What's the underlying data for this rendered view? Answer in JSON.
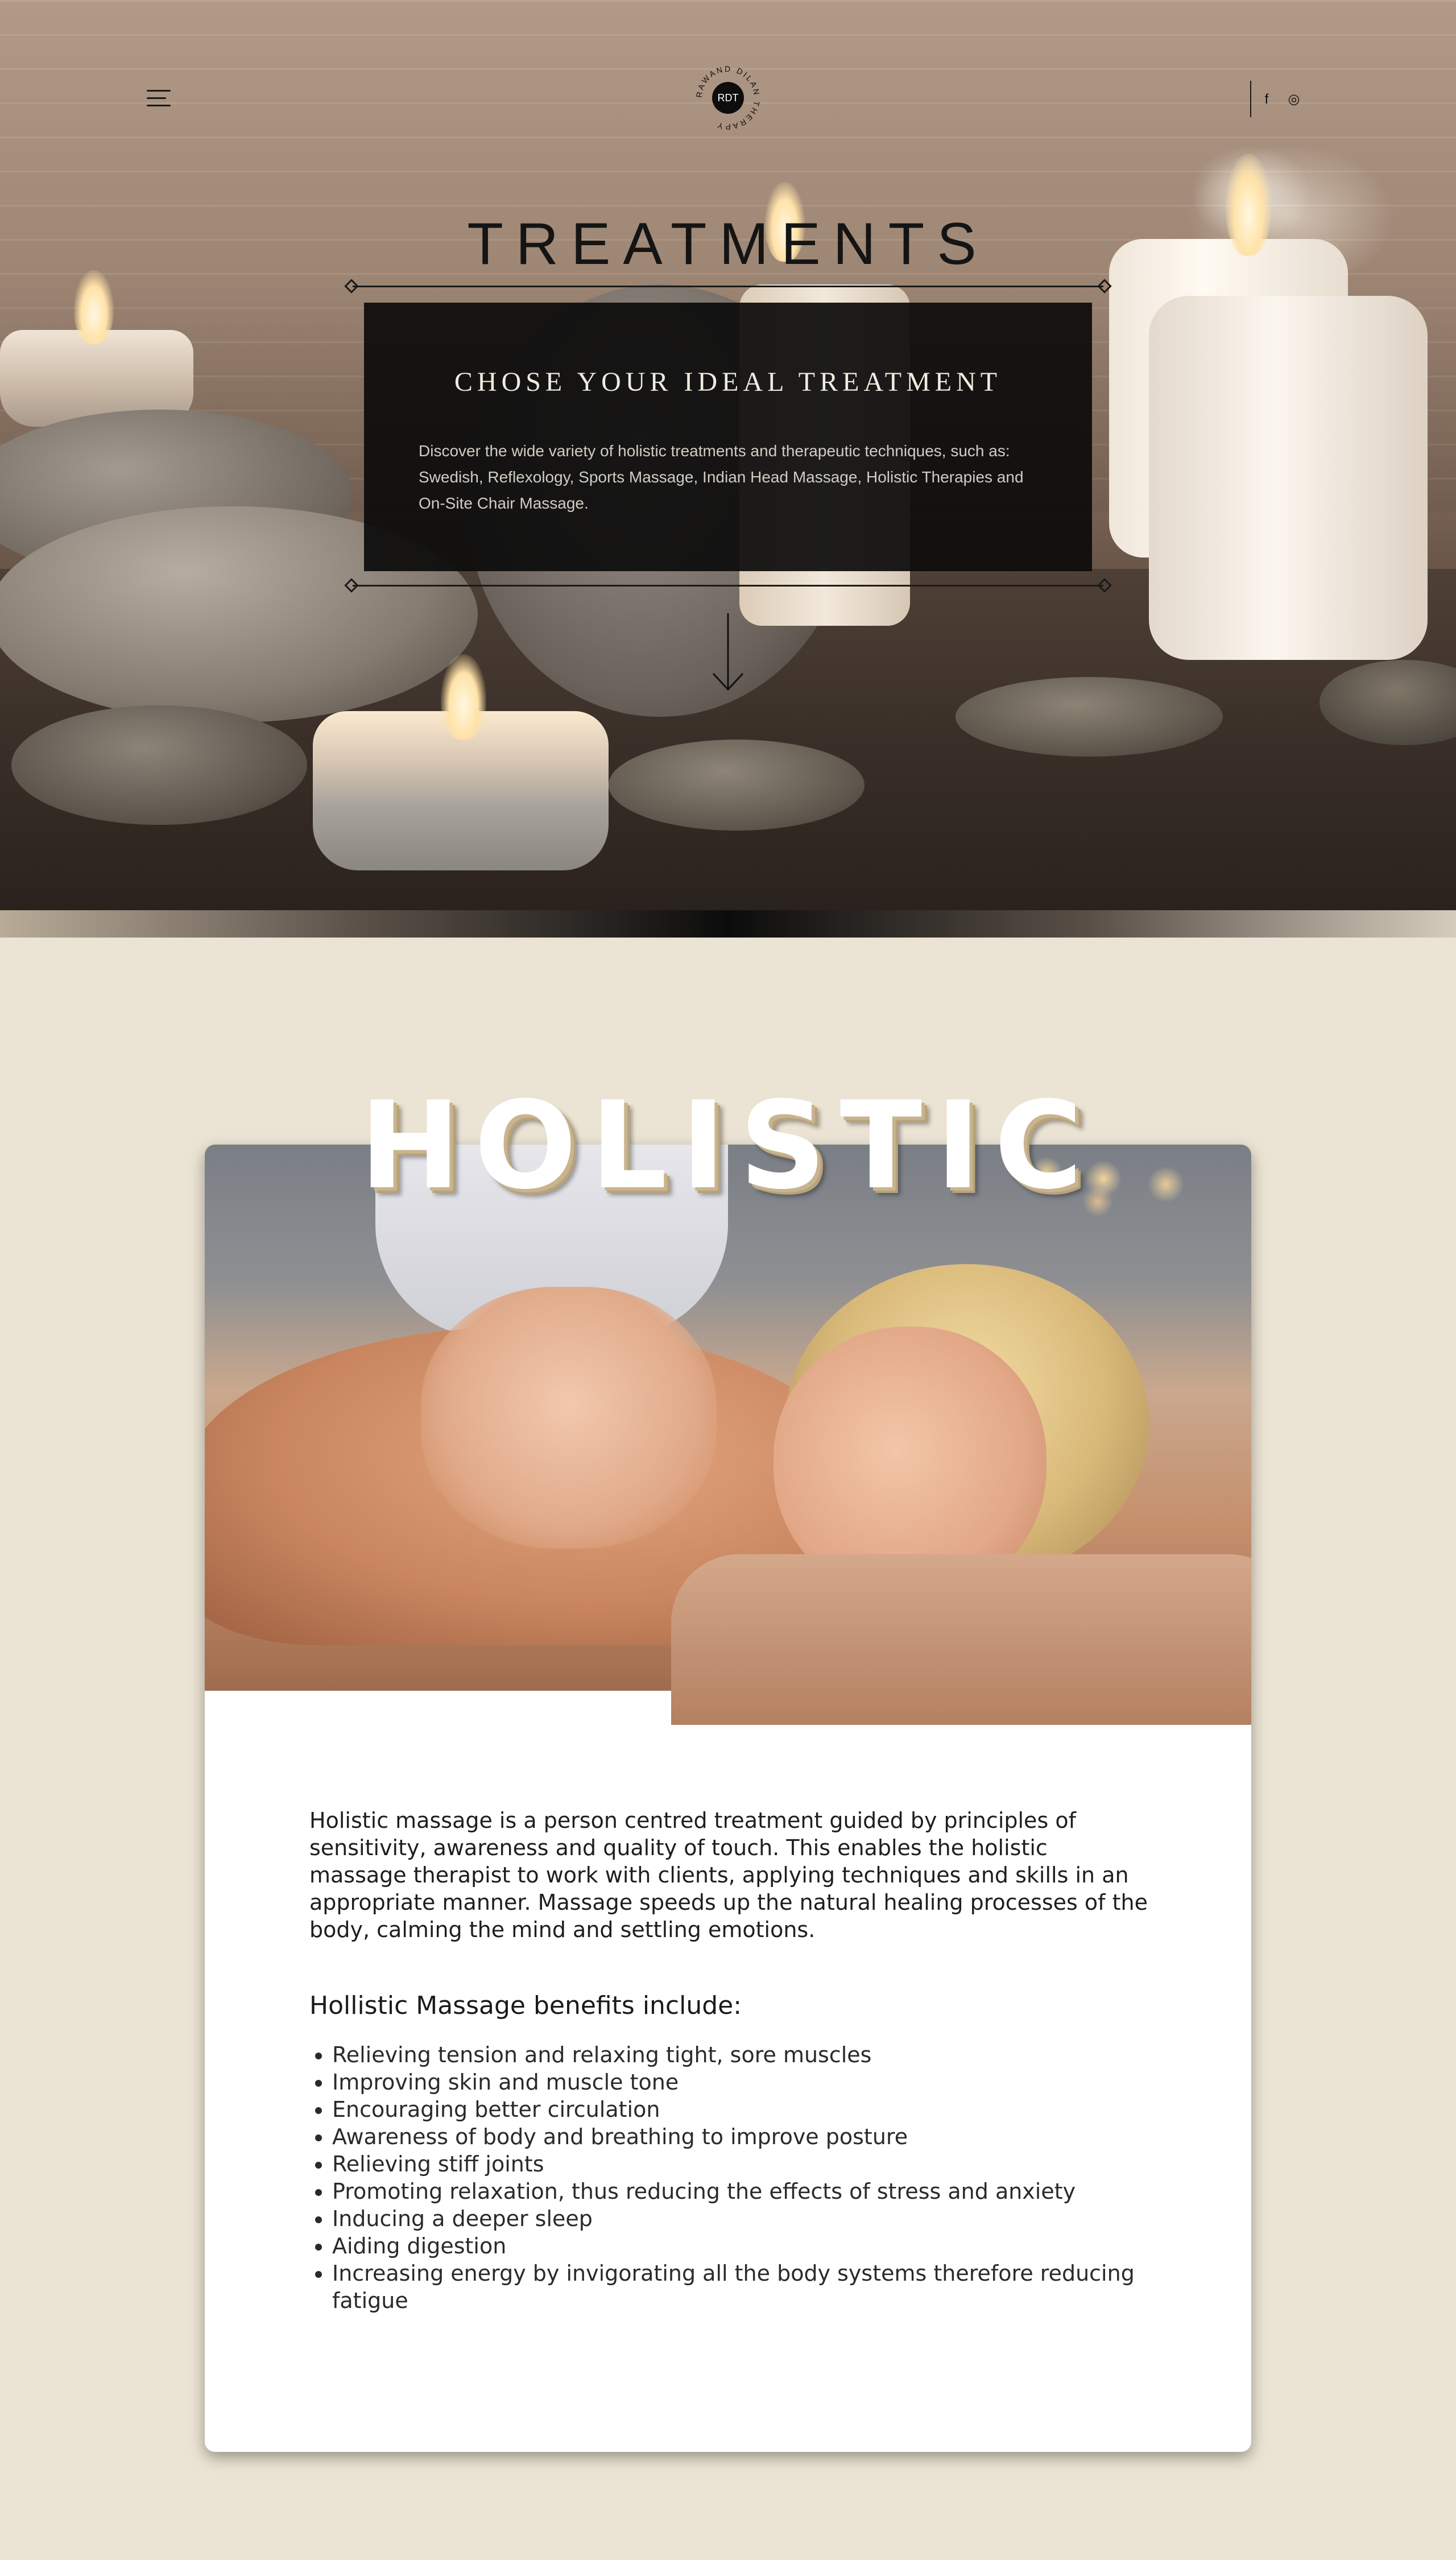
{
  "header": {
    "menu_icon": "hamburger-menu-icon",
    "logo": {
      "monogram": "RDT",
      "ring_text": "RAWAND DILAN THERAPY"
    },
    "social": [
      {
        "name": "facebook-icon",
        "glyph": "f"
      },
      {
        "name": "instagram-icon",
        "glyph": "◎"
      }
    ]
  },
  "hero": {
    "title": "TREATMENTS",
    "box_heading": "CHOSE YOUR IDEAL TREATMENT",
    "box_text": "Discover the wide variety of holistic treatments and therapeutic techniques, such as: Swedish, Reflexology, Sports Massage, Indian Head Massage, Holistic Therapies and On-Site Chair Massage.",
    "scroll_icon": "arrow-down-icon"
  },
  "holistic": {
    "heading": "HOLISTIC",
    "paragraph": "Holistic massage is a person centred treatment guided by principles of sensitivity, awareness and quality of touch. This enables the holistic massage therapist to work with clients, applying techniques and skills in an appropriate manner. Massage speeds up the natural healing processes of the body, calming the mind and settling emotions.",
    "benefits_title": "Hollistic Massage benefits include:",
    "benefits": [
      "Relieving tension and relaxing tight, sore muscles",
      "Improving skin and muscle tone",
      "Encouraging better circulation",
      "Awareness of body and breathing to improve posture",
      "Relieving stiff joints",
      "Promoting relaxation, thus reducing the effects of stress and anxiety",
      "Inducing a deeper sleep",
      "Aiding digestion",
      "Increasing energy by invigorating all the body systems therefore reducing fatigue"
    ]
  },
  "colors": {
    "page_background": "#ebe3d3",
    "info_box": "#0c0c0c",
    "heading_shadow": "#c8b48f"
  }
}
